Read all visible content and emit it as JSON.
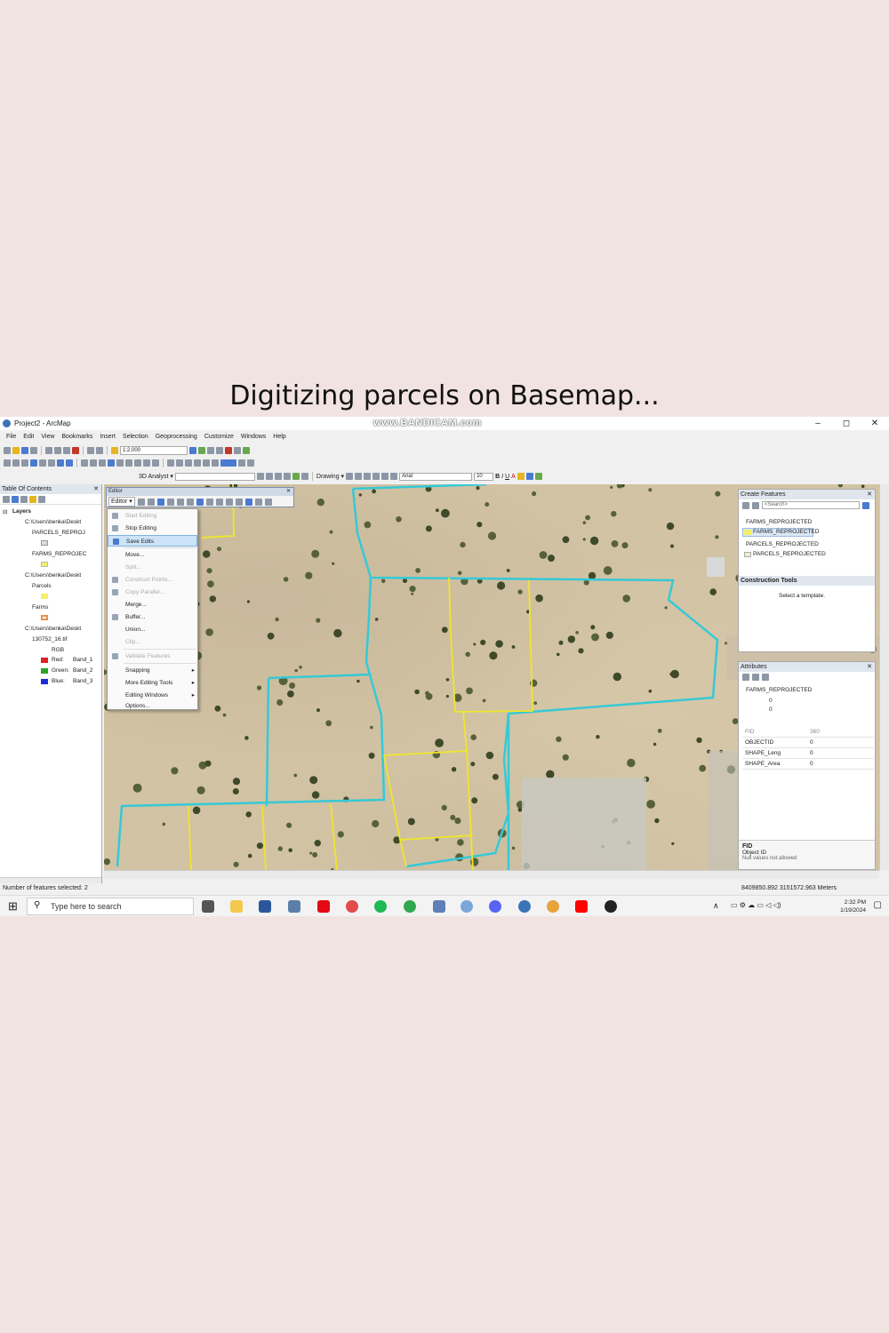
{
  "caption": "Digitizing parcels on Basemap...",
  "window": {
    "title": "Project2 - ArcMap",
    "watermark": "www.BANDICAM.com",
    "minimize": "–",
    "maximize": "◻",
    "close": "✕"
  },
  "menubar": [
    "File",
    "Edit",
    "View",
    "Bookmarks",
    "Insert",
    "Selection",
    "Geoprocessing",
    "Customize",
    "Windows",
    "Help"
  ],
  "toolbar": {
    "scale": "1:2,000",
    "analyst": "3D Analyst ▾",
    "drawing": "Drawing ▾",
    "font": "Arial",
    "font_size": "10",
    "bold": "B",
    "italic": "I",
    "underline": "U",
    "font_color": "A"
  },
  "toc": {
    "title": "Table Of Contents",
    "pin": "✕",
    "layers_label": "Layers",
    "group1": "C:\\Users\\benka\\Deskt",
    "parcels_reproj": "PARCELS_REPROJ",
    "farms_reproj": "FARMS_REPROJEC",
    "group2": "C:\\Users\\benka\\Deskt",
    "parcels": "Parcels",
    "farms": "Farms",
    "group3": "C:\\Users\\benka\\Deskt",
    "raster": "130752_16.tif",
    "rgb": "RGB",
    "red": "Red:",
    "red_band": "Band_1",
    "green": "Green:",
    "green_band": "Band_2",
    "blue": "Blue:",
    "blue_band": "Band_3",
    "colors": {
      "red": "#d9231f",
      "green": "#2aa52a",
      "blue": "#1f2ad9",
      "yellow": "#f2ef6a",
      "orange": "#e8904a"
    }
  },
  "editor_toolbar": {
    "title": "Editor",
    "close": "✕",
    "button": "Editor ▾"
  },
  "editor_menu": {
    "start_editing": "Start Editing",
    "stop_editing": "Stop Editing",
    "save_edits": "Save Edits",
    "move": "Move...",
    "split": "Split...",
    "construct_points": "Construct Points...",
    "copy_parallel": "Copy Parallel...",
    "merge": "Merge...",
    "buffer": "Buffer...",
    "union": "Union...",
    "clip": "Clip...",
    "validate": "Validate Features",
    "snapping": "Snapping",
    "more_tools": "More Editing Tools",
    "editing_windows": "Editing Windows",
    "options": "Options..."
  },
  "create_features": {
    "title": "Create Features",
    "search_placeholder": "<Search>",
    "farms_group": "FARMS_REPROJECTED",
    "farms_template": "FARMS_REPROJECTED",
    "parcels_group": "PARCELS_REPROJECTED",
    "parcels_template": "PARCELS_REPROJECTED",
    "construction_tools": "Construction Tools",
    "hint": "Select a template."
  },
  "attributes": {
    "title": "Attributes",
    "layer": "FARMS_REPROJECTED",
    "child1": "0",
    "child2": "0",
    "rows": [
      {
        "field": "FID",
        "value": "360"
      },
      {
        "field": "OBJECTID",
        "value": "0"
      },
      {
        "field": "SHAPE_Leng",
        "value": "0"
      },
      {
        "field": "SHAPE_Area",
        "value": "0"
      }
    ],
    "footer_title": "FID",
    "footer_desc": "Object ID",
    "footer_note": "Null values not allowed"
  },
  "status": {
    "selected": "Number of features selected: 2",
    "coords": "8409850.892  3151572.963 Meters"
  },
  "taskbar": {
    "search_placeholder": "Type here to search",
    "time": "2:32 PM",
    "date": "1/19/2024"
  }
}
